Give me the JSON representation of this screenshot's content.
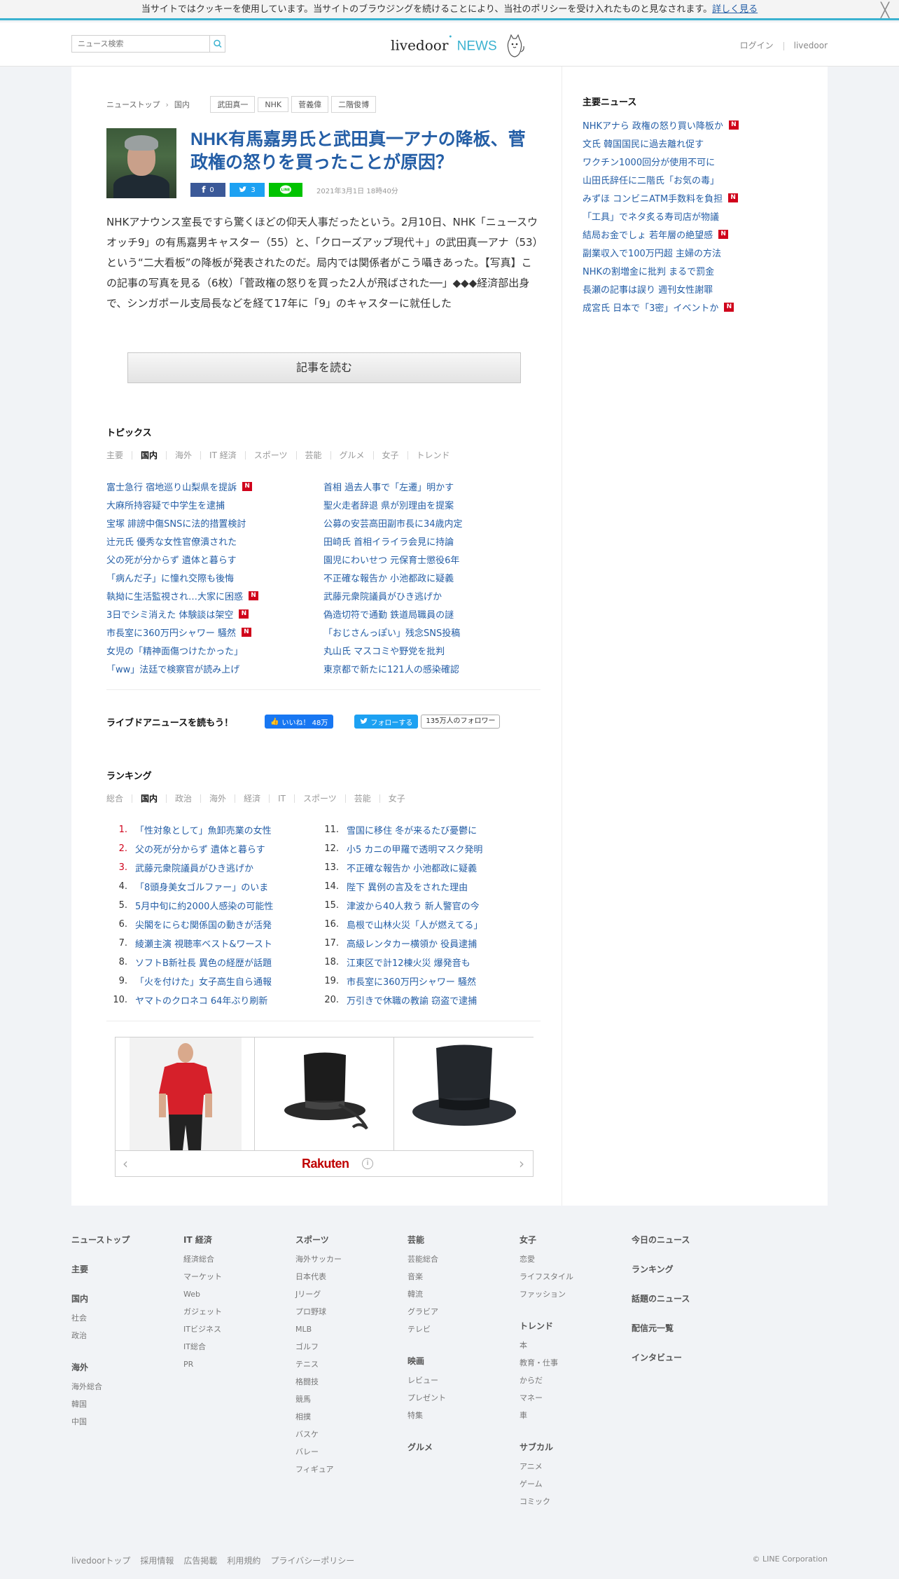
{
  "cookie": {
    "text": "当サイトではクッキーを使用しています。当サイトのブラウジングを続けることにより、当社のポリシーを受け入れたものと見なされます。",
    "link": "詳しく見る",
    "close": "╳"
  },
  "header": {
    "search_placeholder": "ニュース検索",
    "logo_main": "livedoor",
    "logo_news": "NEWS",
    "login": "ログイン",
    "livedoor": "livedoor"
  },
  "breadcrumb": {
    "items": [
      "ニューストップ",
      "国内"
    ],
    "tags": [
      "武田真一",
      "NHK",
      "菅義偉",
      "二階俊博"
    ]
  },
  "article": {
    "title": "NHK有馬嘉男氏と武田真一アナの降板、菅政権の怒りを買ったことが原因？",
    "facebook_count": "0",
    "twitter_count": "3",
    "date": "2021年3月1日 18時40分",
    "lead": "NHKアナウンス室長ですら驚くほどの仰天人事だったという。2月10日、NHK「ニュースウオッチ9」の有馬嘉男キャスター（55）と、「クローズアップ現代＋」の武田真一アナ（53）という“二大看板”の降板が発表されたのだ。局内では関係者がこう囁きあった。【写真】この記事の写真を見る（6枚）「菅政権の怒りを買った2人が飛ばされた──」◆◆◆経済部出身で、シンガポール支局長などを経て17年に「9」のキャスターに就任した",
    "read_button": "記事を読む"
  },
  "topics": {
    "title": "トピックス",
    "tabs": [
      "主要",
      "国内",
      "海外",
      "IT 経済",
      "スポーツ",
      "芸能",
      "グルメ",
      "女子",
      "トレンド"
    ],
    "active_tab": "国内",
    "left": [
      {
        "text": "富士急行 宿地巡り山梨県を提訴",
        "new": true
      },
      {
        "text": "大麻所持容疑で中学生を逮捕",
        "new": false
      },
      {
        "text": "宝塚 誹謗中傷SNSに法的措置検討",
        "new": false
      },
      {
        "text": "辻元氏 優秀な女性官僚潰された",
        "new": false
      },
      {
        "text": "父の死が分からず 遺体と暮らす",
        "new": false
      },
      {
        "text": "「病んだ子」に憧れ交際も後悔",
        "new": false
      },
      {
        "text": "執拗に生活監視され…大家に困惑",
        "new": true
      },
      {
        "text": "3日でシミ消えた 体験談は架空",
        "new": true
      },
      {
        "text": "市長室に360万円シャワー 騒然",
        "new": true
      },
      {
        "text": "女児の「精神面傷つけたかった」",
        "new": false
      },
      {
        "text": "「ww」法廷で検察官が読み上げ",
        "new": false
      }
    ],
    "right": [
      {
        "text": "首相 過去人事で「左遷」明かす",
        "new": false
      },
      {
        "text": "聖火走者辞退 県が別理由を提案",
        "new": false
      },
      {
        "text": "公募の安芸高田副市長に34歳内定",
        "new": false
      },
      {
        "text": "田崎氏 首相イライラ会見に持論",
        "new": false
      },
      {
        "text": "園児にわいせつ 元保育士懲役6年",
        "new": false
      },
      {
        "text": "不正確な報告か 小池都政に疑義",
        "new": false
      },
      {
        "text": "武藤元衆院議員がひき逃げか",
        "new": false
      },
      {
        "text": "偽造切符で通勤 鉄道局職員の謎",
        "new": false
      },
      {
        "text": "「おじさんっぽい」残念SNS投稿",
        "new": false
      },
      {
        "text": "丸山氏 マスコミや野党を批判",
        "new": false
      },
      {
        "text": "東京都で新たに121人の感染確認",
        "new": false
      }
    ]
  },
  "follow": {
    "title": "ライブドアニュースを読もう！",
    "like_label": "いいね！ 48万",
    "twitter_label": "フォローする",
    "twitter_count": "135万人のフォロワー"
  },
  "ranking": {
    "title": "ランキング",
    "tabs": [
      "総合",
      "国内",
      "政治",
      "海外",
      "経済",
      "IT",
      "スポーツ",
      "芸能",
      "女子"
    ],
    "active_tab": "国内",
    "left": [
      {
        "no": "1.",
        "text": "「性対象として」魚卸売業の女性"
      },
      {
        "no": "2.",
        "text": "父の死が分からず 遺体と暮らす"
      },
      {
        "no": "3.",
        "text": "武藤元衆院議員がひき逃げか"
      },
      {
        "no": "4.",
        "text": "「8頭身美女ゴルファー」のいま"
      },
      {
        "no": "5.",
        "text": "5月中旬に約2000人感染の可能性"
      },
      {
        "no": "6.",
        "text": "尖閣をにらむ関係国の動きが活発"
      },
      {
        "no": "7.",
        "text": "綾瀬主演 視聴率ベスト&ワースト"
      },
      {
        "no": "8.",
        "text": "ソフトB新社長 異色の経歴が話題"
      },
      {
        "no": "9.",
        "text": "「火を付けた」女子高生自ら通報"
      },
      {
        "no": "10.",
        "text": "ヤマトのクロネコ 64年ぶり刷新"
      }
    ],
    "right": [
      {
        "no": "11.",
        "text": "雪国に移住 冬が来るたび憂鬱に"
      },
      {
        "no": "12.",
        "text": "小5 カニの甲羅で透明マスク発明"
      },
      {
        "no": "13.",
        "text": "不正確な報告か 小池都政に疑義"
      },
      {
        "no": "14.",
        "text": "陛下 異例の言及をされた理由"
      },
      {
        "no": "15.",
        "text": "津波から40人救う 新人警官の今"
      },
      {
        "no": "16.",
        "text": "島根で山林火災「人が燃えてる」"
      },
      {
        "no": "17.",
        "text": "高級レンタカー横領か 役員逮捕"
      },
      {
        "no": "18.",
        "text": "江東区で計12棟火災 爆発音も"
      },
      {
        "no": "19.",
        "text": "市長室に360万円シャワー 騒然"
      },
      {
        "no": "20.",
        "text": "万引きで休職の教諭 窃盗で逮捕"
      }
    ]
  },
  "ad": {
    "brand": "Rakuten",
    "info": "i",
    "prev": "‹",
    "next": "›"
  },
  "sidebar": {
    "title": "主要ニュース",
    "items": [
      {
        "text": "NHKアナら 政権の怒り買い降板か",
        "new": true
      },
      {
        "text": "文氏 韓国国民に過去離れ促す",
        "new": false
      },
      {
        "text": "ワクチン1000回分が使用不可に",
        "new": false
      },
      {
        "text": "山田氏辞任に二階氏「お気の毒」",
        "new": false
      },
      {
        "text": "みずほ コンビニATM手数料を負担",
        "new": true
      },
      {
        "text": "「工具」でネタ炙る寿司店が物議",
        "new": false
      },
      {
        "text": "結局お金でしょ 若年層の絶望感",
        "new": true
      },
      {
        "text": "副業収入で100万円超 主婦の方法",
        "new": false
      },
      {
        "text": "NHKの割増金に批判 まるで罰金",
        "new": false
      },
      {
        "text": "長瀬の記事は誤り 週刊女性謝罪",
        "new": false
      },
      {
        "text": "成宮氏 日本で「3密」イベントか",
        "new": true
      }
    ]
  },
  "new_badge": "N",
  "footer": {
    "col1": [
      {
        "h": "ニューストップ",
        "items": []
      },
      {
        "h": "主要",
        "items": []
      },
      {
        "h": "国内",
        "items": [
          "社会",
          "政治"
        ]
      },
      {
        "h": "海外",
        "items": [
          "海外総合",
          "韓国",
          "中国"
        ]
      }
    ],
    "col2": [
      {
        "h": "IT 経済",
        "items": [
          "経済総合",
          "マーケット",
          "Web",
          "ガジェット",
          "ITビジネス",
          "IT総合",
          "PR"
        ]
      }
    ],
    "col3": [
      {
        "h": "スポーツ",
        "items": [
          "海外サッカー",
          "日本代表",
          "Jリーグ",
          "プロ野球",
          "MLB",
          "ゴルフ",
          "テニス",
          "格闘技",
          "競馬",
          "相撲",
          "バスケ",
          "バレー",
          "フィギュア"
        ]
      }
    ],
    "col4": [
      {
        "h": "芸能",
        "items": [
          "芸能総合",
          "音楽",
          "韓流",
          "グラビア",
          "テレビ"
        ]
      },
      {
        "h": "映画",
        "items": [
          "レビュー",
          "プレゼント",
          "特集"
        ]
      },
      {
        "h": "グルメ",
        "items": []
      }
    ],
    "col5": [
      {
        "h": "女子",
        "items": [
          "恋愛",
          "ライフスタイル",
          "ファッション"
        ]
      },
      {
        "h": "トレンド",
        "items": [
          "本",
          "教育・仕事",
          "からだ",
          "マネー",
          "車"
        ]
      },
      {
        "h": "サブカル",
        "items": [
          "アニメ",
          "ゲーム",
          "コミック"
        ]
      }
    ],
    "col6": [
      {
        "h": "今日のニュース",
        "items": []
      },
      {
        "h": "ランキング",
        "items": []
      },
      {
        "h": "話題のニュース",
        "items": []
      },
      {
        "h": "配信元一覧",
        "items": []
      },
      {
        "h": "インタビュー",
        "items": []
      }
    ],
    "bottom_links": [
      "livedoorトップ",
      "採用情報",
      "広告掲載",
      "利用規約",
      "プライバシーポリシー"
    ],
    "copyright": "© LINE Corporation"
  },
  "colors": {
    "link": "#245ea6",
    "accent": "#3bb2d0",
    "badge": "#d0021b"
  }
}
